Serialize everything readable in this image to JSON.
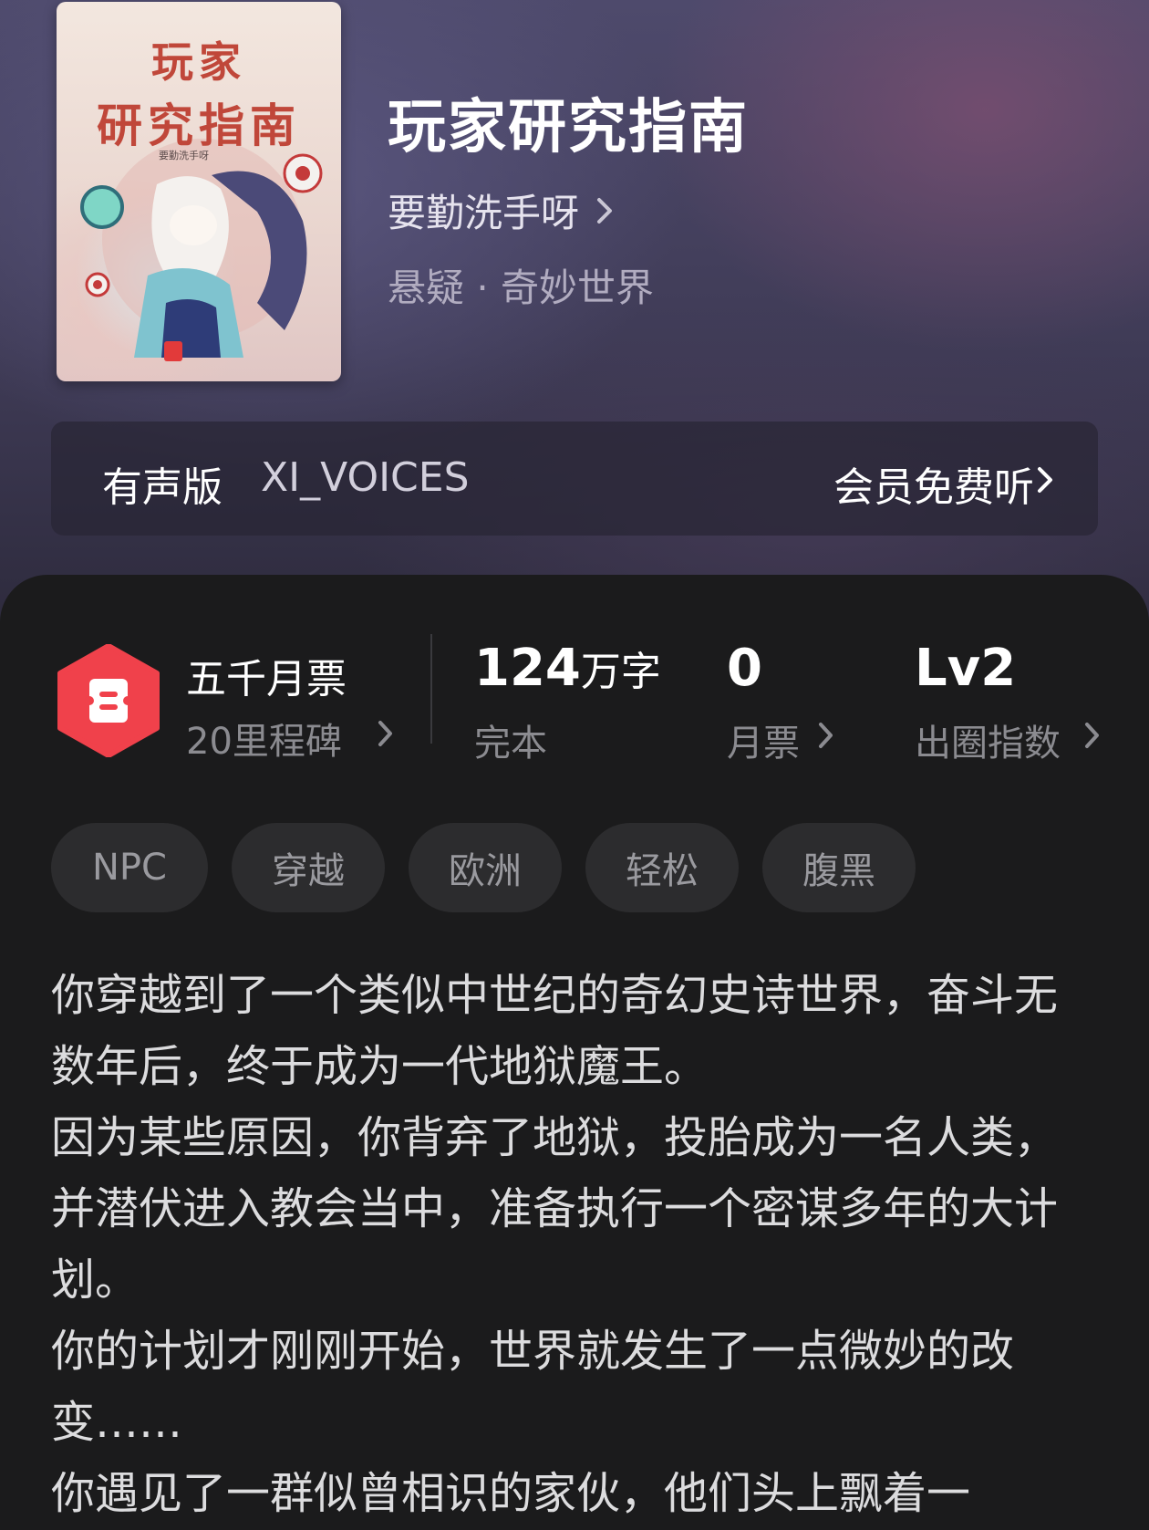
{
  "book": {
    "cover": {
      "title_line1": "玩家",
      "title_line2": "研究指南",
      "author": "要勤洗手呀"
    },
    "title": "玩家研究指南",
    "author": "要勤洗手呀",
    "genre": "悬疑 · 奇妙世界"
  },
  "audio": {
    "label": "有声版",
    "voice": "XI_VOICES",
    "action": "会员免费听"
  },
  "stats": {
    "milestone_title": "五千月票",
    "milestone_sub": "20里程碑",
    "word_count_num": "124",
    "word_count_unit": "万字",
    "status": "完本",
    "monthly_votes": "0",
    "monthly_votes_label": "月票",
    "level": "Lv2",
    "level_label": "出圈指数"
  },
  "tags": [
    "NPC",
    "穿越",
    "欧洲",
    "轻松",
    "腹黑"
  ],
  "description": [
    "你穿越到了一个类似中世纪的奇幻史诗世界，奋斗无数年后，终于成为一代地狱魔王。",
    "因为某些原因，你背弃了地狱，投胎成为一名人类，并潜伏进入教会当中，准备执行一个密谋多年的大计划。",
    "你的计划才刚刚开始，世界就发生了一点微妙的改变……",
    "你遇见了一群似曾相识的家伙，他们头上飘着一"
  ],
  "colors": {
    "badge": "#f0414b",
    "panel_bg": "#1b1b1c",
    "tag_bg": "#2c2c2e"
  }
}
